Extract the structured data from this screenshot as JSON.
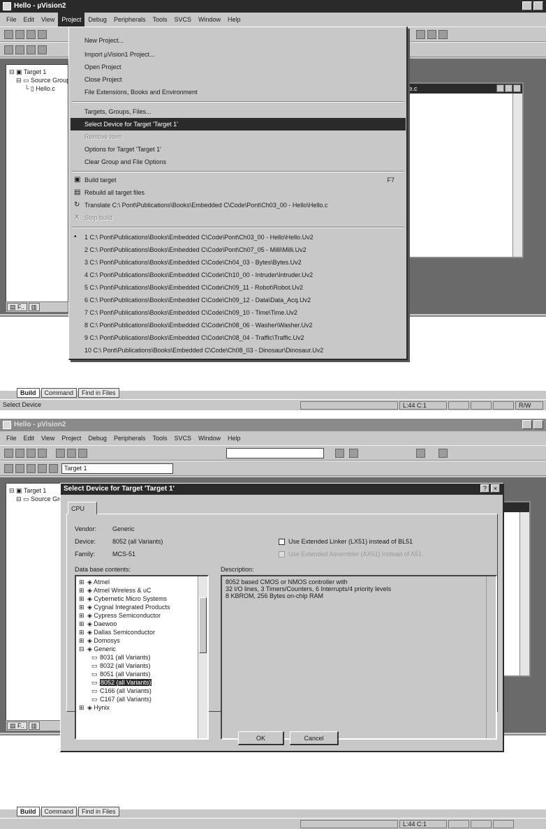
{
  "shot1": {
    "window_title": "Hello - µVision2",
    "menus": [
      "File",
      "Edit",
      "View",
      "Project",
      "Debug",
      "Peripherals",
      "Tools",
      "SVCS",
      "Window",
      "Help"
    ],
    "project_menu": {
      "items": [
        {
          "label": "New Project...",
          "state": "normal"
        },
        {
          "label": "Import µVision1 Project...",
          "state": "normal"
        },
        {
          "label": "Open Project",
          "state": "normal"
        },
        {
          "label": "Close Project",
          "state": "normal"
        },
        {
          "label": "File Extensions, Books and Environment",
          "state": "normal"
        },
        {
          "label": "Targets, Groups, Files...",
          "state": "normal"
        },
        {
          "label": "Select Device for Target 'Target 1'",
          "state": "selected"
        },
        {
          "label": "Remove Item",
          "state": "disabled"
        },
        {
          "label": "Options for Target 'Target 1'",
          "state": "normal"
        },
        {
          "label": "Clear Group and File Options",
          "state": "normal"
        },
        {
          "label": "Build target",
          "shortcut": "F7",
          "state": "normal"
        },
        {
          "label": "Rebuild all target files",
          "state": "normal"
        },
        {
          "label": "Translate C:\\ Pont\\Publications\\Books\\Embedded C\\Code\\Pont\\Ch03_00 - Hello\\Hello.c",
          "state": "normal"
        },
        {
          "label": "Stop build",
          "state": "disabled"
        }
      ],
      "recent": [
        "1 C:\\ Pont\\Publications\\Books\\Embedded C\\Code\\Pont\\Ch03_00 - Hello\\Hello.Uv2",
        "2 C:\\ Pont\\Publications\\Books\\Embedded C\\Code\\Pont\\Ch07_05 - Milli\\Milli.Uv2",
        "3 C:\\ Pont\\Publications\\Books\\Embedded C\\Code\\Ch04_03 - Bytes\\Bytes.Uv2",
        "4 C:\\ Pont\\Publications\\Books\\Embedded C\\Code\\Ch10_00 - Intruder\\Intruder.Uv2",
        "5 C:\\ Pont\\Publications\\Books\\Embedded C\\Code\\Ch09_11 - Robot\\Robot.Uv2",
        "6 C:\\ Pont\\Publications\\Books\\Embedded C\\Code\\Ch09_12 - Data\\Data_Acq.Uv2",
        "7 C:\\ Pont\\Publications\\Books\\Embedded C\\Code\\Ch09_10 - Time\\Time.Uv2",
        "8 C:\\ Pont\\Publications\\Books\\Embedded C\\Code\\Ch08_06 - Washer\\Washer.Uv2",
        "9 C:\\ Pont\\Publications\\Books\\Embedded C\\Code\\Ch08_04 - Traffic\\Traffic.Uv2",
        "10 C:\\ Pont\\Publications\\Books\\Embedded C\\Code\\Ch08_03 - Dinosaur\\Dinosaur.Uv2"
      ]
    },
    "tree": [
      "Target 1",
      "Source Group",
      "Hello.c"
    ],
    "editor_title": "File.c",
    "output_tabs": [
      "Build",
      "Command",
      "Find in Files"
    ],
    "status_left": "Select Device",
    "status_pos": "L:44 C:1",
    "status_right": "R/W"
  },
  "shot2": {
    "window_title": "Hello - µVision2",
    "menus": [
      "File",
      "Edit",
      "View",
      "Project",
      "Debug",
      "Peripherals",
      "Tools",
      "SVCS",
      "Window",
      "Help"
    ],
    "target_select": "Target 1",
    "dialog": {
      "title": "Select Device for Target 'Target 1'",
      "help_btn": "?",
      "close_btn": "×",
      "tab": "CPU",
      "vendor_label": "Vendor:",
      "vendor_value": "Generic",
      "device_label": "Device:",
      "device_value": "8052 (all Variants)",
      "family_label": "Family:",
      "family_value": "MCS-51",
      "chk_extended_linker": "Use Extended Linker (LX51) instead of BL51",
      "chk_extended_assembler": "Use Extended Assembler (AX51) instead of A51",
      "database_label": "Data base contents:",
      "description_label": "Description:",
      "database_items": [
        {
          "label": "Atmel",
          "kind": "vendor"
        },
        {
          "label": "Atmel Wireless & uC",
          "kind": "vendor"
        },
        {
          "label": "Cybernetic Micro Systems",
          "kind": "vendor"
        },
        {
          "label": "Cygnal Integrated Products",
          "kind": "vendor"
        },
        {
          "label": "Cypress Semiconductor",
          "kind": "vendor"
        },
        {
          "label": "Daewoo",
          "kind": "vendor"
        },
        {
          "label": "Dallas Semiconductor",
          "kind": "vendor"
        },
        {
          "label": "Domosys",
          "kind": "vendor"
        },
        {
          "label": "Generic",
          "kind": "vendor-open"
        },
        {
          "label": "8031 (all Variants)",
          "kind": "device"
        },
        {
          "label": "8032 (all Variants)",
          "kind": "device"
        },
        {
          "label": "8051 (all Variants)",
          "kind": "device"
        },
        {
          "label": "8052 (all Variants)",
          "kind": "device-selected"
        },
        {
          "label": "C166 (all Variants)",
          "kind": "device"
        },
        {
          "label": "C167 (all Variants)",
          "kind": "device"
        },
        {
          "label": "Hynix",
          "kind": "vendor"
        }
      ],
      "description": "8052 based CMOS or NMOS controller with\n32 I/O lines, 3 Timers/Counters, 6 Interrupts/4 priority levels\n8 KBROM, 256 Bytes on-chip RAM",
      "ok_label": "OK",
      "cancel_label": "Cancel"
    },
    "output_tabs": [
      "Build",
      "Command",
      "Find in Files"
    ],
    "status_pos": "L:44 C:1"
  },
  "colors": {
    "face": "#c8c8c8",
    "title_active": "#2a2a2a",
    "workspace": "#6a6a6a"
  }
}
